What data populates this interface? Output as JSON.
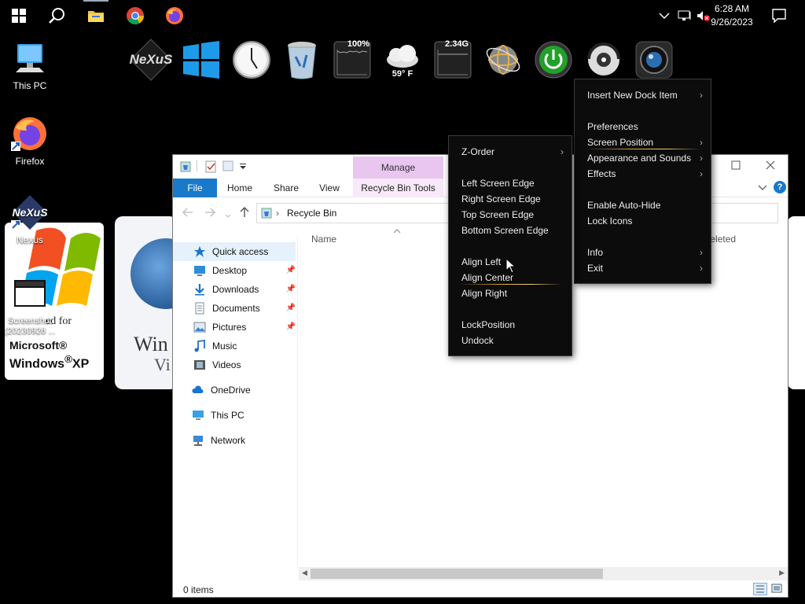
{
  "taskbar": {
    "pinned": [
      "start-button",
      "search-button",
      "file-explorer",
      "chrome",
      "firefox"
    ],
    "clock_time": "6:28 AM",
    "clock_date": "9/26/2023"
  },
  "desktop": {
    "icons": [
      {
        "label": "This PC"
      },
      {
        "label": "Firefox"
      },
      {
        "label": "Nexus"
      },
      {
        "label": "Screenshot (20230926 ..."
      }
    ],
    "xp_logo_text": "Designed for Microsoft® Windows® XP",
    "vista_logo_text": "Windows Vista"
  },
  "dock": {
    "logo": "NeXuS",
    "cpu_meter": "100%",
    "weather_temp": "59° F",
    "ram_meter": "2.34G"
  },
  "explorer": {
    "manage_header": "Manage",
    "tabs": {
      "file": "File",
      "home": "Home",
      "share": "Share",
      "view": "View",
      "recycle_bin_tools": "Recycle Bin Tools"
    },
    "address": "Recycle Bin",
    "column_name": "Name",
    "column_date_deleted": "Date Deleted",
    "nav": {
      "quick_access": "Quick access",
      "desktop": "Desktop",
      "downloads": "Downloads",
      "documents": "Documents",
      "pictures": "Pictures",
      "music": "Music",
      "videos": "Videos",
      "onedrive": "OneDrive",
      "this_pc": "This PC",
      "network": "Network"
    },
    "status": "0 items"
  },
  "dock_menu": {
    "items": [
      {
        "label": "Insert New Dock Item",
        "submenu": true
      },
      {
        "label": "Preferences",
        "submenu": false
      },
      {
        "label": "Screen Position",
        "submenu": true,
        "highlighted": true
      },
      {
        "label": "Appearance and Sounds",
        "submenu": true
      },
      {
        "label": "Effects",
        "submenu": true
      },
      {
        "label": "Enable Auto-Hide",
        "submenu": false
      },
      {
        "label": "Lock Icons",
        "submenu": false
      },
      {
        "label": "Info",
        "submenu": true
      },
      {
        "label": "Exit",
        "submenu": true
      }
    ]
  },
  "position_menu": {
    "items": [
      {
        "label": "Z-Order",
        "submenu": true
      },
      {
        "label": "Left Screen Edge"
      },
      {
        "label": "Right Screen Edge"
      },
      {
        "label": "Top Screen Edge"
      },
      {
        "label": "Bottom Screen Edge"
      },
      {
        "label": "Align Left"
      },
      {
        "label": "Align Center",
        "highlighted": true
      },
      {
        "label": "Align Right"
      },
      {
        "label": "LockPosition"
      },
      {
        "label": "Undock"
      }
    ]
  },
  "colors": {
    "file_tab": "#1979ca",
    "manage_header": "#e8c6f0",
    "menu_bg": "#0c0c0c",
    "highlight_underline": "#d8a440"
  }
}
